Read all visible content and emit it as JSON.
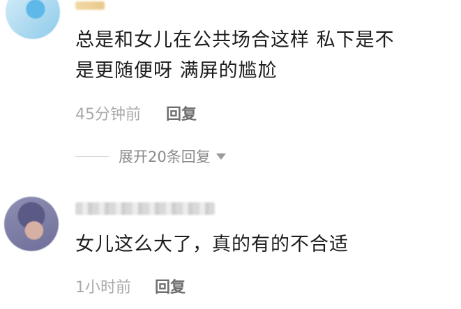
{
  "comments": [
    {
      "text_lines": [
        "总是和女儿在公共场合这样 私下是不",
        "是更随便呀 满屏的尴尬"
      ],
      "time": "45分钟前",
      "reply_label": "回复",
      "expand_label": "展开20条回复"
    },
    {
      "text_lines": [
        "女儿这么大了，真的有的不合适"
      ],
      "time": "1小时前",
      "reply_label": "回复"
    }
  ],
  "icons": {
    "expand": "caret-down-icon"
  }
}
